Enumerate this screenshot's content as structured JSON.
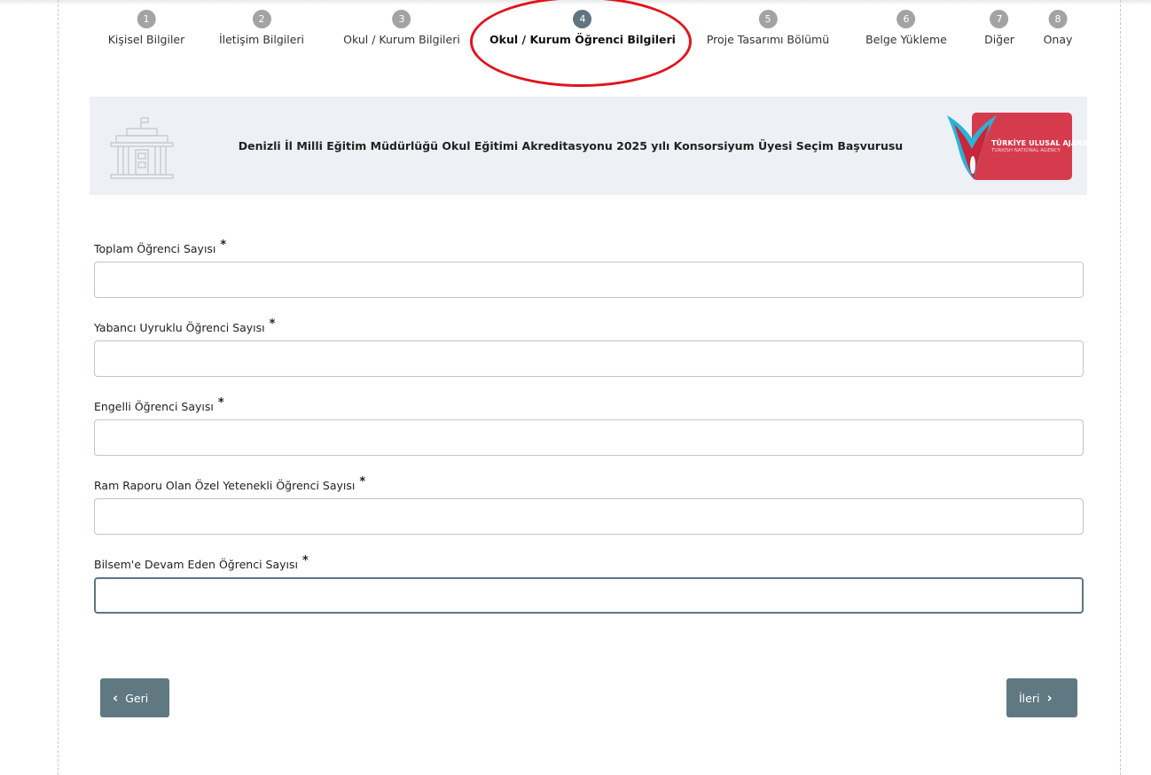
{
  "stepper": {
    "steps": [
      {
        "num": "1",
        "label": "Kişisel Bilgiler"
      },
      {
        "num": "2",
        "label": "İletişim Bilgileri"
      },
      {
        "num": "3",
        "label": "Okul / Kurum Bilgileri"
      },
      {
        "num": "4",
        "label": "Okul / Kurum Öğrenci Bilgileri"
      },
      {
        "num": "5",
        "label": "Proje Tasarımı Bölümü"
      },
      {
        "num": "6",
        "label": "Belge Yükleme"
      },
      {
        "num": "7",
        "label": "Diğer"
      },
      {
        "num": "8",
        "label": "Onay"
      }
    ],
    "active_step": 4
  },
  "banner": {
    "title": "Denizli İl Milli Eğitim Müdürlüğü Okul Eğitimi Akreditasyonu 2025 yılı Konsorsiyum Üyesi Seçim Başvurusu",
    "logo_text": "TÜRKİYE ULUSAL AJANSI",
    "logo_subtext": "TURKISH NATIONAL AGENCY",
    "building_icon": "building-icon"
  },
  "form": {
    "required_mark": "*",
    "fields": [
      {
        "label": "Toplam Öğrenci Sayısı",
        "value": "",
        "placeholder": ""
      },
      {
        "label": "Yabancı Uyruklu Öğrenci Sayısı",
        "value": "",
        "placeholder": ""
      },
      {
        "label": "Engelli Öğrenci Sayısı",
        "value": "",
        "placeholder": ""
      },
      {
        "label": "Ram Raporu Olan Özel Yetenekli Öğrenci Sayısı",
        "value": "",
        "placeholder": ""
      },
      {
        "label": "Bilsem'e Devam Eden Öğrenci Sayısı",
        "value": "",
        "placeholder": ""
      }
    ]
  },
  "nav": {
    "back_label": "Geri",
    "next_label": "İleri",
    "back_icon": "chevron-left-icon",
    "next_icon": "chevron-right-icon"
  },
  "colors": {
    "active_step": "#5f7580",
    "inactive_step": "#a3a3a3",
    "highlight": "#e0141c",
    "button": "#607881",
    "banner_bg": "#edf1f6",
    "logo_red": "#d63b4d"
  }
}
